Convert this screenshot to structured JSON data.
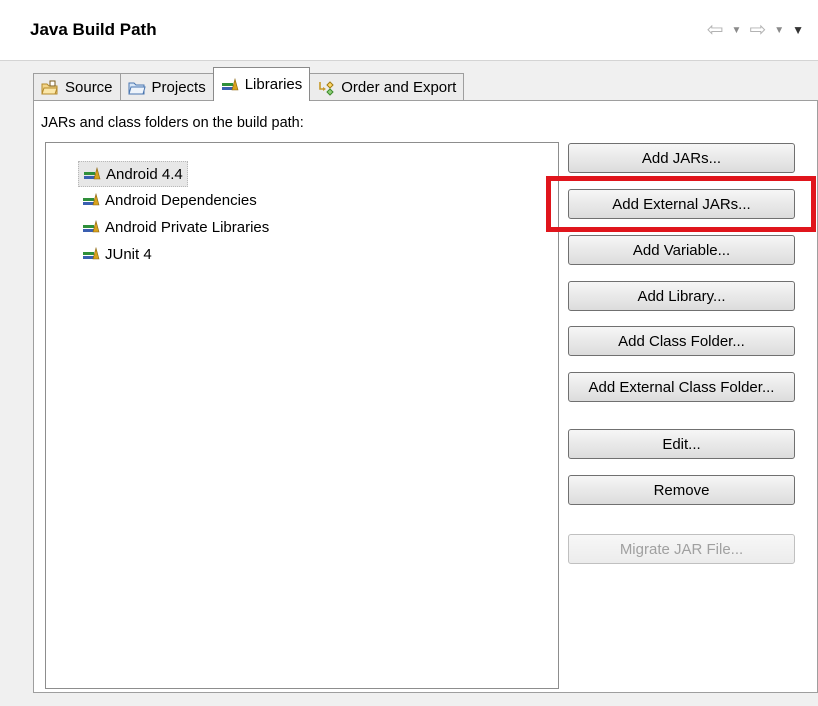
{
  "header": {
    "title": "Java Build Path"
  },
  "nav": {
    "back_icon": "back-arrow-icon",
    "forward_icon": "forward-arrow-icon"
  },
  "tabs": [
    {
      "label": "Source",
      "icon": "source-folder-icon"
    },
    {
      "label": "Projects",
      "icon": "project-folder-icon"
    },
    {
      "label": "Libraries",
      "icon": "library-icon",
      "active": true
    },
    {
      "label": "Order and Export",
      "icon": "order-export-icon"
    }
  ],
  "libraries": {
    "label": "JARs and class folders on the build path:",
    "items": [
      {
        "label": "Android 4.4",
        "selected": true
      },
      {
        "label": "Android Dependencies"
      },
      {
        "label": "Android Private Libraries"
      },
      {
        "label": "JUnit 4"
      }
    ]
  },
  "buttons": {
    "add_jars": "Add JARs...",
    "add_external_jars": "Add External JARs...",
    "add_variable": "Add Variable...",
    "add_library": "Add Library...",
    "add_class_folder": "Add Class Folder...",
    "add_external_class_folder": "Add External Class Folder...",
    "edit": "Edit...",
    "remove": "Remove",
    "migrate_jar": "Migrate JAR File..."
  },
  "colors": {
    "highlight": "#e0151c",
    "library_green": "#2f8f3a",
    "library_gold": "#d8a21c"
  }
}
